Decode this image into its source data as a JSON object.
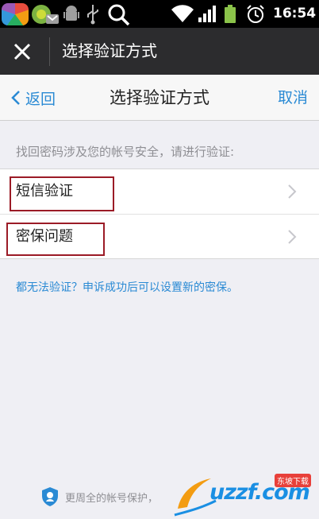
{
  "status_bar": {
    "time": "16:54",
    "icons": [
      "app-launcher-icon",
      "browser-icon",
      "android-debug-icon",
      "usb-icon",
      "search-icon",
      "wifi-icon",
      "signal-icon",
      "battery-icon",
      "alarm-icon"
    ]
  },
  "app_bar": {
    "title": "选择验证方式"
  },
  "nav": {
    "back_label": "返回",
    "title": "选择验证方式",
    "cancel_label": "取消"
  },
  "hint": "找回密码涉及您的帐号安全，请进行验证:",
  "options": [
    {
      "label": "短信验证"
    },
    {
      "label": "密保问题"
    }
  ],
  "bottom_link": "都无法验证？申诉成功后可以设置新的密保。",
  "footer": {
    "text": "更周全的帐号保护，"
  },
  "watermark": {
    "text": "uzzf.com",
    "cn_text": "东坡下载"
  },
  "colors": {
    "accent": "#2a8ad4",
    "highlight_box": "#9b1b26",
    "app_bar": "#2c2c2e",
    "background": "#efeff4"
  }
}
